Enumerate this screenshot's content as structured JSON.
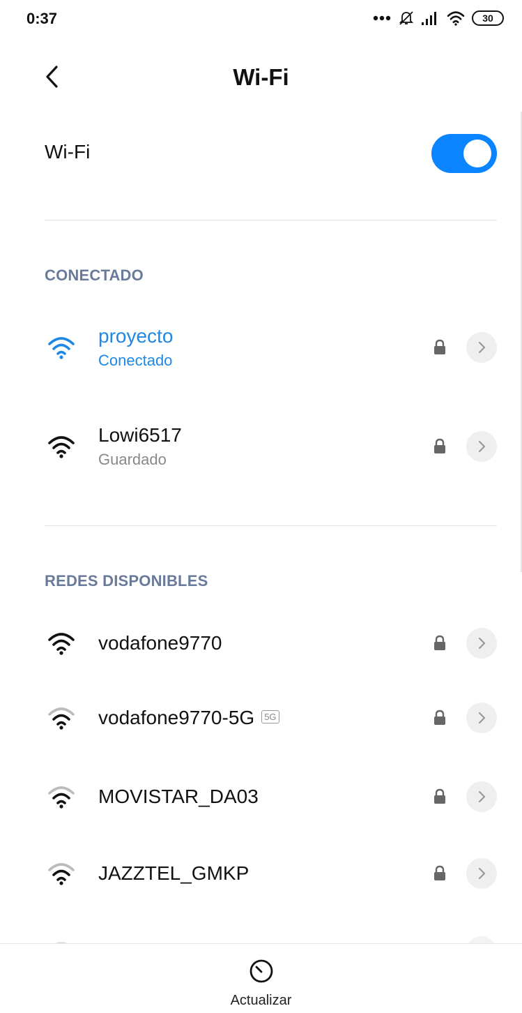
{
  "status_bar": {
    "time": "0:37",
    "battery": "30"
  },
  "header": {
    "title": "Wi-Fi",
    "back_icon": "chevron-left-icon"
  },
  "wifi_toggle": {
    "label": "Wi-Fi",
    "enabled": true,
    "accent_color": "#0a84ff"
  },
  "connected_section": {
    "header": "CONECTADO",
    "networks": [
      {
        "name": "proyecto",
        "status": "Conectado",
        "connected": true,
        "locked": true
      },
      {
        "name": "Lowi6517",
        "status": "Guardado",
        "connected": false,
        "locked": true
      }
    ]
  },
  "available_section": {
    "header": "REDES DISPONIBLES",
    "networks": [
      {
        "name": "vodafone9770",
        "locked": true,
        "badge": ""
      },
      {
        "name": "vodafone9770-5G",
        "locked": true,
        "badge": "5G"
      },
      {
        "name": "MOVISTAR_DA03",
        "locked": true,
        "badge": ""
      },
      {
        "name": "JAZZTEL_GMKP",
        "locked": true,
        "badge": ""
      }
    ]
  },
  "bottom_bar": {
    "refresh_label": "Actualizar",
    "refresh_icon": "refresh-icon"
  },
  "colors": {
    "connected": "#1e88e5",
    "section_header": "#6a7a9a"
  }
}
